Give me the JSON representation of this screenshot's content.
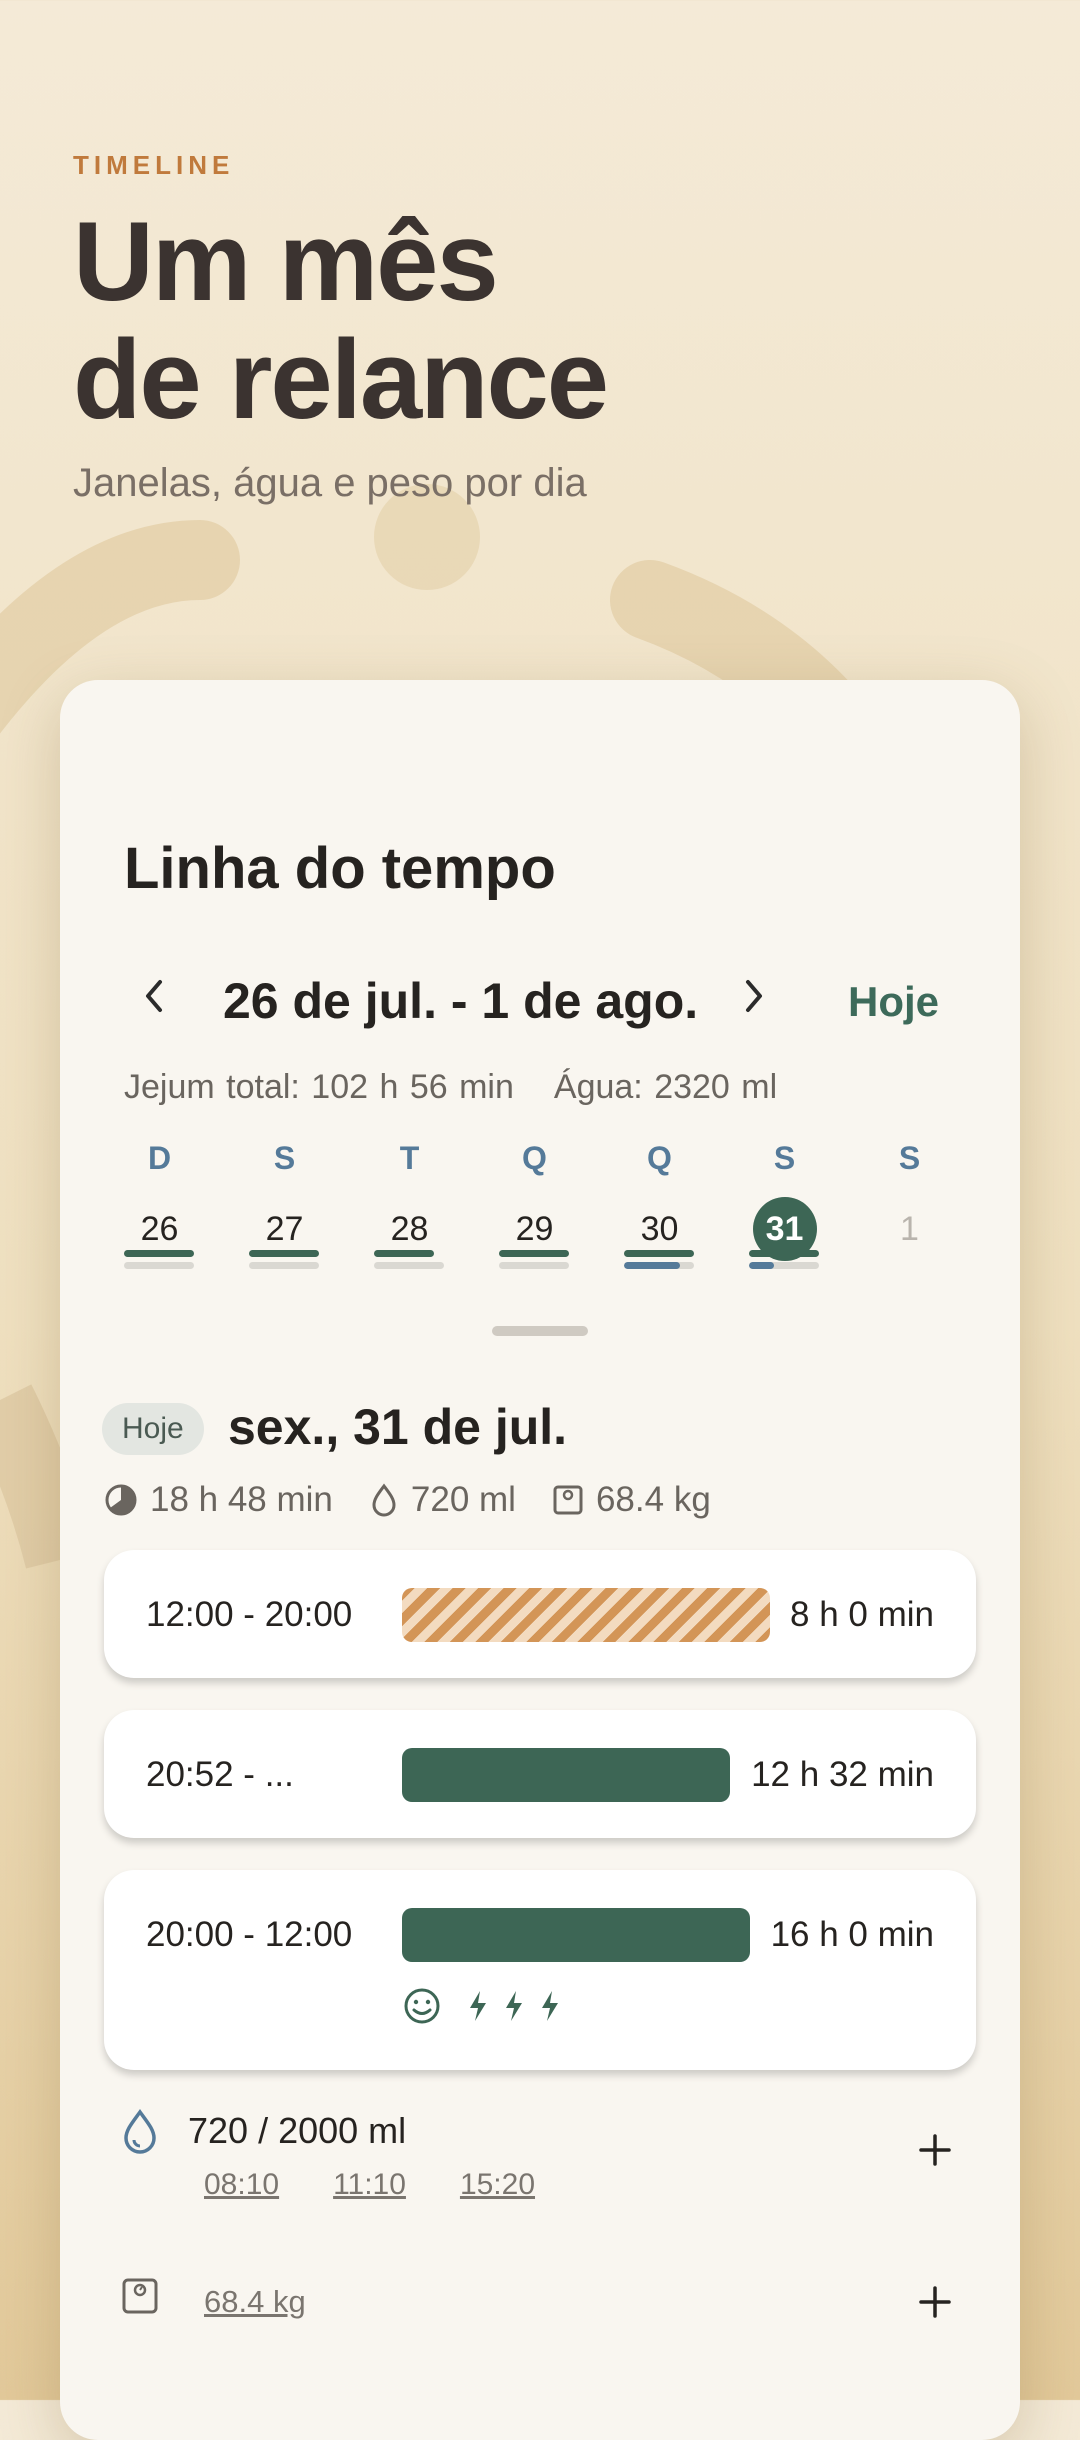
{
  "hero": {
    "eyebrow": "TIMELINE",
    "headline_line1": "Um mês",
    "headline_line2": "de relance",
    "subtitle": "Janelas, água e peso por dia"
  },
  "card": {
    "title": "Linha do tempo",
    "range": "26 de jul. - 1 de ago.",
    "today_button": "Hoje",
    "fast_total": "Jejum total: 102 h 56 min",
    "water_total": "Água: 2320 ml"
  },
  "week": [
    {
      "dow": "D",
      "num": "26",
      "fast_level": 1.0,
      "water_level": 1.0
    },
    {
      "dow": "S",
      "num": "27",
      "fast_level": 1.0,
      "water_level": 1.0
    },
    {
      "dow": "T",
      "num": "28",
      "fast_level": 0.85,
      "water_level": 1.0
    },
    {
      "dow": "Q",
      "num": "29",
      "fast_level": 1.0,
      "water_level": 1.0
    },
    {
      "dow": "Q",
      "num": "30",
      "fast_level": 1.0,
      "water_level": 0.8
    },
    {
      "dow": "S",
      "num": "31",
      "fast_level": 1.0,
      "water_level": 0.36,
      "selected": true
    },
    {
      "dow": "S",
      "num": "1",
      "future": true
    }
  ],
  "day": {
    "badge": "Hoje",
    "title": "sex., 31 de jul.",
    "fast": "18 h 48 min",
    "water": "720 ml",
    "weight": "68.4 kg"
  },
  "windows": [
    {
      "time": "12:00 - 20:00",
      "duration": "8 h 0 min",
      "kind": "plan",
      "fill": 0.92
    },
    {
      "time": "20:52 - ...",
      "duration": "12 h 32 min",
      "kind": "fast",
      "fill": 0.82
    },
    {
      "time": "20:00 - 12:00",
      "duration": "16 h 0 min",
      "kind": "fast",
      "fill": 0.87,
      "mood": "smile-icon",
      "energy": 3
    }
  ],
  "water": {
    "amount": "720 / 2000 ml",
    "times": [
      "08:10",
      "11:10",
      "15:20"
    ]
  },
  "weight": {
    "value": "68.4 kg"
  },
  "colors": {
    "accent_green": "#3d6655",
    "accent_blue": "#557a99",
    "accent_orange": "#c07a3c"
  }
}
